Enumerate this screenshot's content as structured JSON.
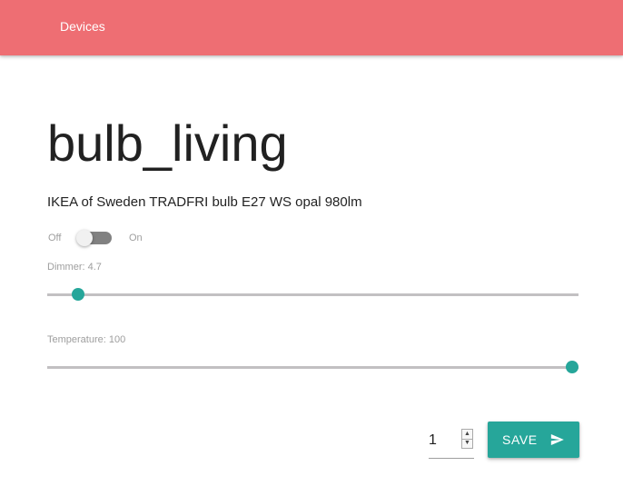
{
  "nav": {
    "link_label": "Devices",
    "background": "#ee6e73"
  },
  "device": {
    "name": "bulb_living",
    "model": "IKEA of Sweden TRADFRI bulb E27 WS opal 980lm"
  },
  "power_switch": {
    "off_label": "Off",
    "on_label": "On",
    "state": "off"
  },
  "dimmer": {
    "label": "Dimmer: 4.7",
    "value": 4.7,
    "min": 0,
    "max": 100
  },
  "temperature": {
    "label": "Temperature: 100",
    "value": 100,
    "min": 0,
    "max": 100
  },
  "transition_input": {
    "value": "1"
  },
  "save_button": {
    "label": "SAVE",
    "icon": "send-icon"
  },
  "colors": {
    "accent": "#26a69a",
    "track": "#c2c0c2"
  }
}
